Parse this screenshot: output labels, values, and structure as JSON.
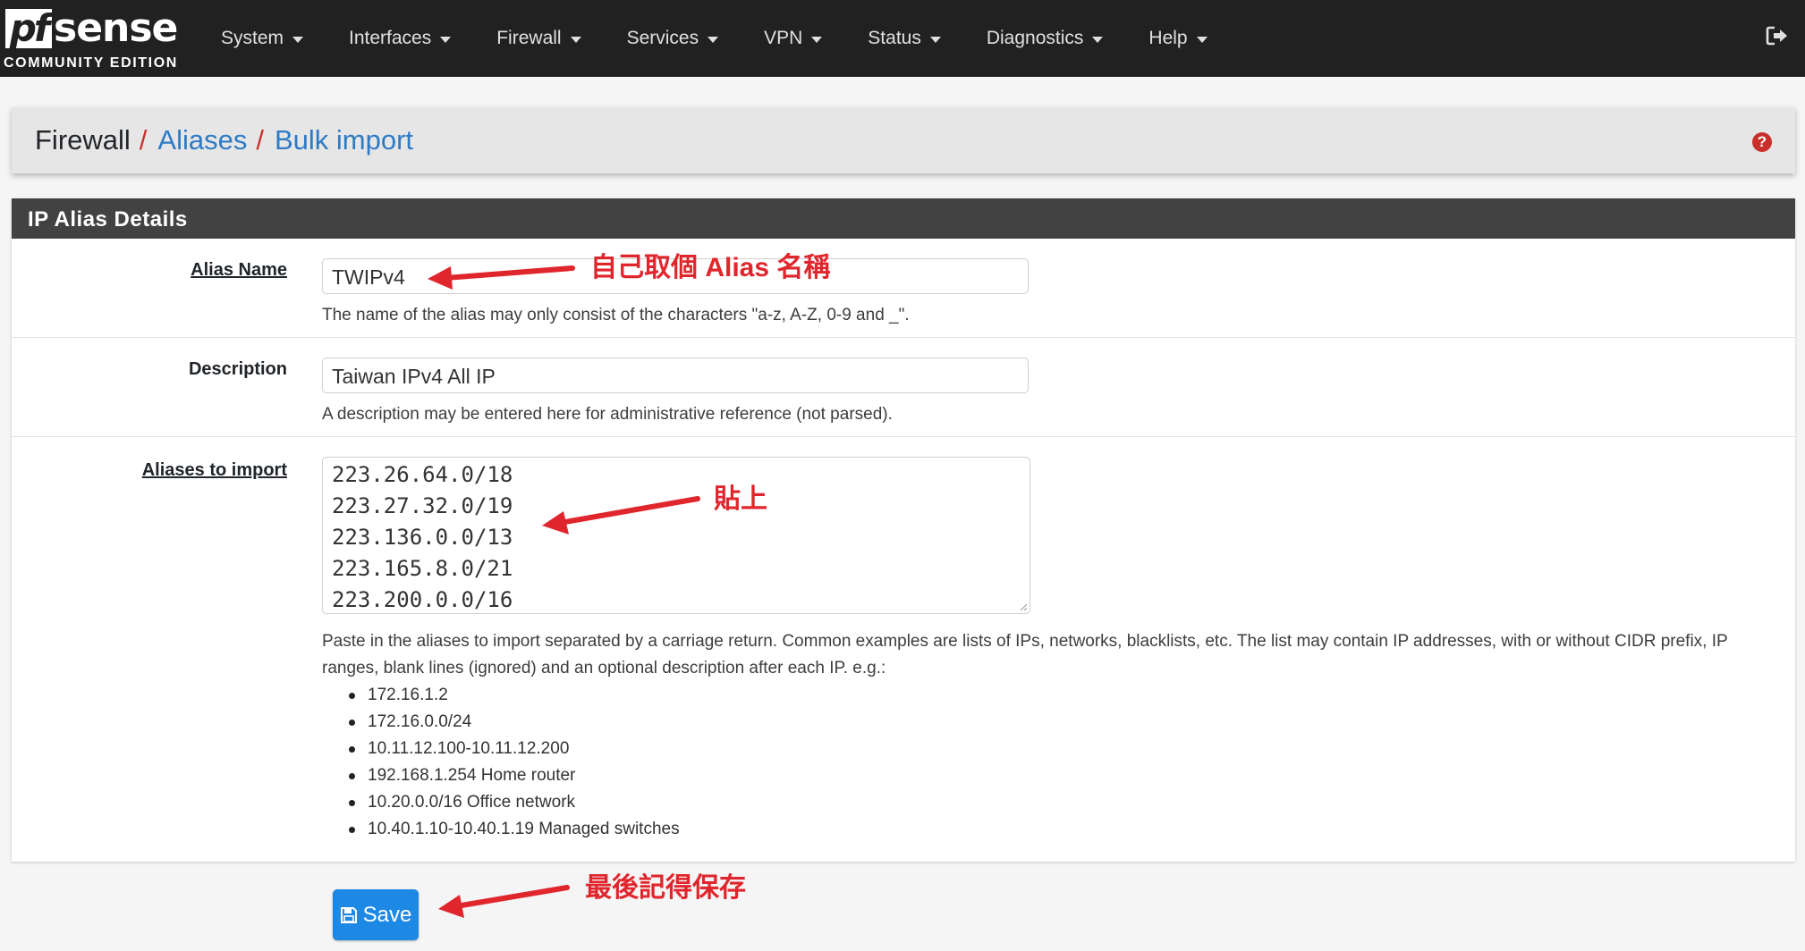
{
  "brand": {
    "logo_pf": "pf",
    "logo_sense": "sense",
    "logo_edition": "COMMUNITY EDITION"
  },
  "nav": {
    "items": [
      "System",
      "Interfaces",
      "Firewall",
      "Services",
      "VPN",
      "Status",
      "Diagnostics",
      "Help"
    ]
  },
  "breadcrumb": {
    "root": "Firewall",
    "sep": "/",
    "aliases": "Aliases",
    "current": "Bulk import"
  },
  "panel": {
    "title": "IP Alias Details"
  },
  "form": {
    "alias_name": {
      "label": "Alias Name",
      "value": "TWIPv4",
      "hint": "The name of the alias may only consist of the characters \"a-z, A-Z, 0-9 and _\"."
    },
    "description": {
      "label": "Description",
      "value": "Taiwan IPv4 All IP",
      "hint": "A description may be entered here for administrative reference (not parsed)."
    },
    "import": {
      "label": "Aliases to import",
      "lines": [
        "223.26.64.0/18",
        "223.27.32.0/19",
        "223.136.0.0/13",
        "223.165.8.0/21",
        "223.200.0.0/16"
      ],
      "hint": "Paste in the aliases to import separated by a carriage return. Common examples are lists of IPs, networks, blacklists, etc. The list may contain IP addresses, with or without CIDR prefix, IP ranges, blank lines (ignored) and an optional description after each IP. e.g.:",
      "examples": [
        "172.16.1.2",
        "172.16.0.0/24",
        "10.11.12.100-10.11.12.200",
        "192.168.1.254 Home router",
        "10.20.0.0/16 Office network",
        "10.40.1.10-10.40.1.19 Managed switches"
      ]
    }
  },
  "save_label": "Save",
  "annotations": {
    "name_note": "自己取個 Alias 名稱",
    "paste_note": "貼上",
    "save_note": "最後記得保存"
  },
  "colors": {
    "topbar": "#212121",
    "link": "#2e7bc4",
    "separator": "#c9302c",
    "panel_header": "#424242",
    "save_button": "#1e88e5",
    "annotation": "#e0262d"
  },
  "icons": {
    "logout": "logout-icon",
    "help": "help-icon",
    "save": "floppy-disk-icon"
  }
}
